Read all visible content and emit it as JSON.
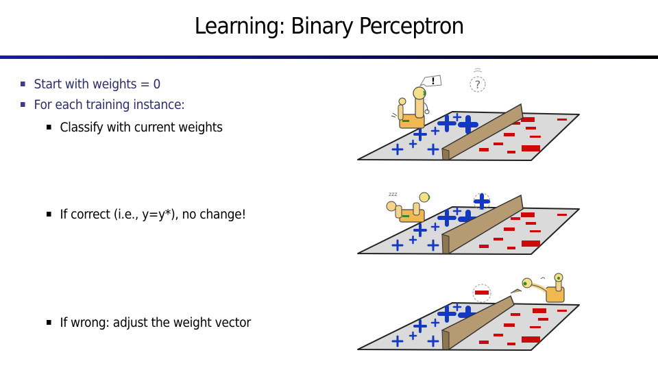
{
  "slide": {
    "title": "Learning: Binary Perceptron",
    "bullets": [
      {
        "level": 1,
        "text": "Start with weights = 0"
      },
      {
        "level": 1,
        "text": "For each training instance:"
      },
      {
        "level": 2,
        "text": "Classify with current weights"
      },
      {
        "level": 2,
        "text": "If correct (i.e., y=y*), no change!"
      },
      {
        "level": 2,
        "text": "If wrong: adjust the weight vector"
      }
    ]
  },
  "illustrations": [
    {
      "name": "classify",
      "thought_bubble": "!",
      "query_symbol": "?",
      "robot_state": "looking"
    },
    {
      "name": "correct",
      "thought_bubble": "zzz",
      "query_symbol": "+",
      "robot_state": "sleeping"
    },
    {
      "name": "wrong",
      "query_symbol": "-",
      "robot_state": "pushing fence"
    }
  ],
  "colors": {
    "positive": "#1438c0",
    "negative": "#cc0a0a",
    "plane": "#d9d9d9",
    "fence": "#b59a72",
    "robot": "#f2c96a",
    "title_rule_start": "#1a1aa8",
    "title_rule_end": "#000000",
    "bullet_level1": "#2c2c6c"
  }
}
